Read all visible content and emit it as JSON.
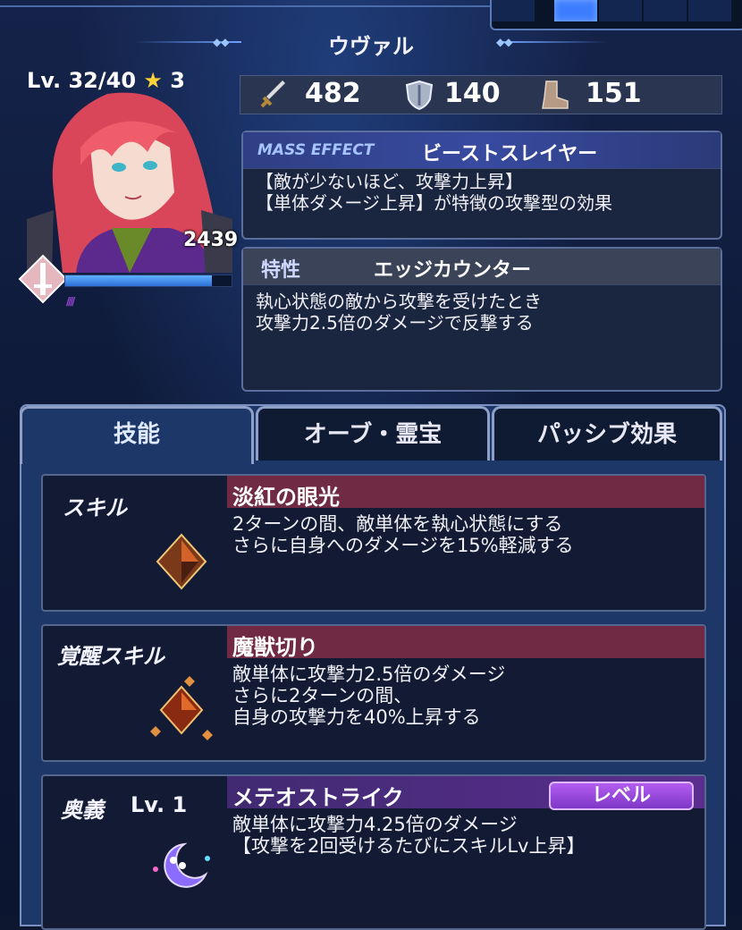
{
  "character": {
    "name": "ウヴァル",
    "level_label": "Lv. 32/40",
    "star_count": "3",
    "power": "2439"
  },
  "stats": {
    "attack": "482",
    "defense": "140",
    "speed": "151"
  },
  "mass_effect": {
    "tag": "MASS EFFECT",
    "name": "ビーストスレイヤー",
    "desc_line1": "【敵が少ないほど、攻撃力上昇】",
    "desc_line2": "【単体ダメージ上昇】が特徴の攻撃型の効果"
  },
  "trait": {
    "tag": "特性",
    "name": "エッジカウンター",
    "desc_line1": "執心状態の敵から攻撃を受けたとき",
    "desc_line2": "攻撃力2.5倍のダメージで反撃する"
  },
  "tabs": [
    "技能",
    "オーブ・霊宝",
    "パッシブ効果"
  ],
  "skills": [
    {
      "label": "スキル",
      "name": "淡紅の眼光",
      "lines": [
        "2ターンの間、敵単体を執心状態にする",
        "さらに自身へのダメージを15%軽減する"
      ]
    },
    {
      "label": "覚醒スキル",
      "name": "魔獣切り",
      "lines": [
        "敵単体に攻撃力2.5倍のダメージ",
        "さらに2ターンの間、",
        "自身の攻撃力を40%上昇する"
      ]
    },
    {
      "label": "奥義",
      "level": "Lv. 1",
      "name": "メテオストライク",
      "button": "レベル",
      "lines": [
        "敵単体に攻撃力4.25倍のダメージ",
        "【攻撃を2回受けるたびにスキルLv上昇】"
      ]
    }
  ],
  "colors": {
    "skill_bar": "#702a44",
    "ult_bar": "#5a2e8e",
    "level_button": "#a552e6",
    "hp_bar": "#3d8cf0"
  },
  "icons": {
    "attack": "sword-icon",
    "defense": "shield-icon",
    "speed": "boot-icon",
    "class": "sword-class-icon",
    "star": "star-icon"
  }
}
